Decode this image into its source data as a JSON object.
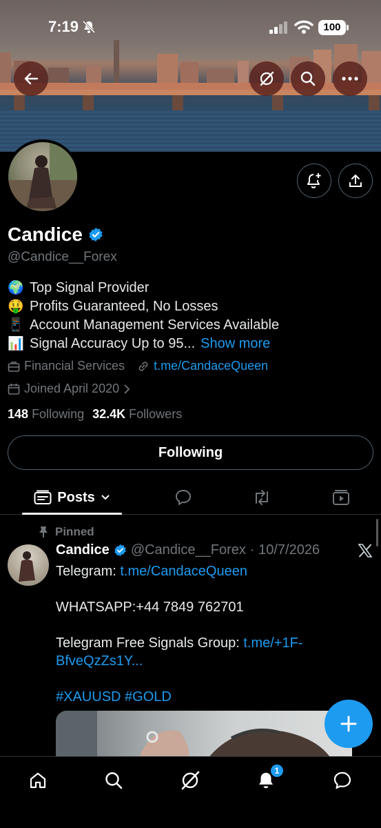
{
  "status_bar": {
    "time": "7:19",
    "battery": "100"
  },
  "profile": {
    "name": "Candice",
    "handle": "@Candice__Forex",
    "bio": [
      {
        "emoji": "🌍",
        "text": "Top Signal Provider"
      },
      {
        "emoji": "🤑",
        "text": "Profits Guaranteed, No Losses"
      },
      {
        "emoji": "📱",
        "text": "Account Management Services Available"
      },
      {
        "emoji": "📊",
        "text": "Signal Accuracy Up to 95...",
        "more": "Show more"
      }
    ],
    "category": "Financial Services",
    "website": "t.me/CandaceQueen",
    "joined": "Joined April 2020",
    "following_count": "148",
    "following_label": "Following",
    "followers_count": "32.4K",
    "followers_label": "Followers",
    "follow_button": "Following"
  },
  "tabs": {
    "posts": "Posts"
  },
  "post": {
    "pinned_label": "Pinned",
    "name": "Candice",
    "handle": "@Candice__Forex",
    "date": "· 10/7/2026",
    "line1_prefix": "Telegram: ",
    "line1_link": "t.me/CandaceQueen",
    "line2": "WHATSAPP:+44 7849 762701",
    "line3_prefix": "Telegram Free Signals Group: ",
    "line3_link": "t.me/+1F-BfveQzZs1Y...",
    "hashtags": "#XAUUSD #GOLD"
  },
  "bottom_nav": {
    "notification_badge": "1"
  },
  "colors": {
    "accent": "#1d9bf0",
    "muted": "#71767b",
    "background": "#000000"
  }
}
